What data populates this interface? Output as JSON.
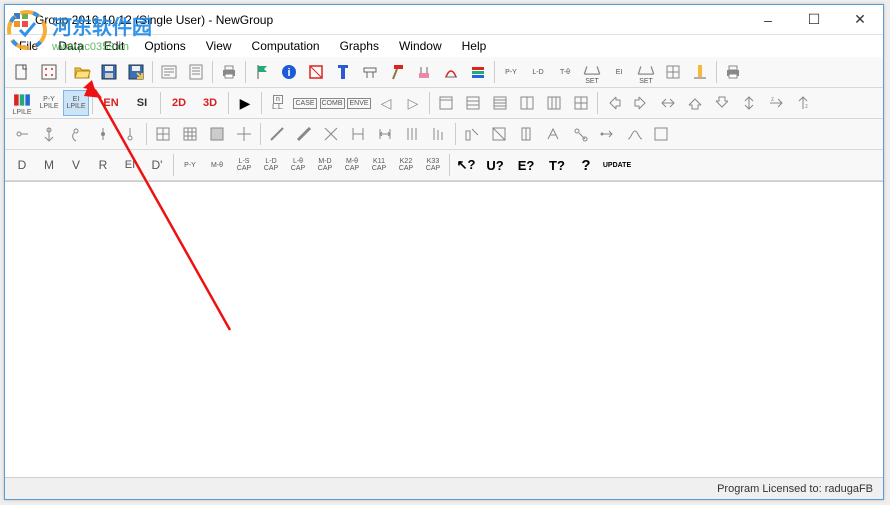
{
  "title": "Group 2016.10.12 (Single User) - NewGroup",
  "menu": {
    "file": "File",
    "data": "Data",
    "edit": "Edit",
    "options": "Options",
    "view": "View",
    "computation": "Computation",
    "graphs": "Graphs",
    "window": "Window",
    "help": "Help"
  },
  "watermark": {
    "main": "河东软件园",
    "url": "www.pc0359.cn"
  },
  "status": "Program Licensed to: radugaFB",
  "row1": {
    "b1": "",
    "b2": "",
    "b3": "",
    "b4": "",
    "b5": "",
    "b6": "",
    "b7": "",
    "b8": "",
    "b9": "",
    "b10": "",
    "b11": "",
    "b12": "",
    "b13": "",
    "b14": "",
    "b15": "",
    "b16": "",
    "b17": "",
    "b18": "",
    "b19": "",
    "b20": "P-Y",
    "b21": "L-D",
    "b22": "T-θ",
    "b23": "SET",
    "b24": "EI",
    "b25": "SET",
    "b26": "",
    "b27": "",
    "b28": ""
  },
  "row2": {
    "b1": "LPILE",
    "b2": "P-Y",
    "b2s": "LPILE",
    "b3": "EI",
    "b3s": "LPILE",
    "b4": "EN",
    "b5": "SI",
    "b6": "2D",
    "b7": "3D",
    "b8": "▶",
    "b9": "n",
    "b9s": "L.L.",
    "b10": "CASE",
    "b11": "COMB",
    "b12": "ENVE",
    "b13": "◁",
    "b14": "▷",
    "b15": "",
    "b16": "",
    "b17": "",
    "b18": "",
    "b19": "",
    "b20": "",
    "b21": "",
    "b22": "",
    "b23": "",
    "b24": "",
    "b25": "",
    "b26": "",
    "b27": "",
    "b28": ""
  },
  "row3": {
    "b1": "",
    "b2": "",
    "b3": "",
    "b4": "",
    "b5": "",
    "b6": "",
    "b7": "",
    "b8": "",
    "b9": "",
    "b10": "",
    "b11": "",
    "b12": "",
    "b13": "",
    "b14": "",
    "b15": "",
    "b16": "",
    "b17": "",
    "b18": "",
    "b19": "",
    "b20": "",
    "b21": "",
    "b22": "",
    "b23": "",
    "b24": "",
    "b25": "",
    "b26": "",
    "b27": "",
    "b28": ""
  },
  "row4": {
    "b1": "D",
    "b2": "M",
    "b3": "V",
    "b4": "R",
    "b5": "EI",
    "b6": "D'",
    "b7": "P-Y",
    "b8": "M-θ",
    "b9": "L-S",
    "b9s": "CAP",
    "b10": "L-D",
    "b10s": "CAP",
    "b11": "L-θ",
    "b11s": "CAP",
    "b12": "M-D",
    "b12s": "CAP",
    "b13": "M-θ",
    "b13s": "CAP",
    "b14": "K11",
    "b14s": "CAP",
    "b15": "K22",
    "b15s": "CAP",
    "b16": "K33",
    "b16s": "CAP",
    "b17": "↖?",
    "b18": "U?",
    "b19": "E?",
    "b20": "T?",
    "b21": "?",
    "b22": "UPDATE"
  }
}
